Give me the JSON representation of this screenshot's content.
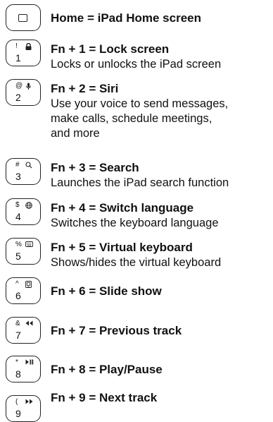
{
  "shortcuts": [
    {
      "key_top": "",
      "key_bottom": "",
      "key_icon": "home-square-icon",
      "title": "Home = iPad Home screen",
      "desc": ""
    },
    {
      "key_top": "!",
      "key_bottom": "1",
      "key_icon": "lock-icon",
      "title": "Fn + 1 = Lock screen",
      "desc": "Locks or unlocks the iPad screen"
    },
    {
      "key_top": "@",
      "key_bottom": "2",
      "key_icon": "microphone-icon",
      "title": "Fn + 2 = Siri",
      "desc": "Use your voice to send messages,\nmake calls, schedule meetings,\nand more"
    },
    {
      "key_top": "#",
      "key_bottom": "3",
      "key_icon": "search-icon",
      "title": "Fn + 3 = Search",
      "desc": "Launches the iPad search function"
    },
    {
      "key_top": "$",
      "key_bottom": "4",
      "key_icon": "globe-icon",
      "title": "Fn + 4 = Switch language",
      "desc": "Switches the keyboard language"
    },
    {
      "key_top": "%",
      "key_bottom": "5",
      "key_icon": "keyboard-icon",
      "title": "Fn + 5 = Virtual keyboard",
      "desc": "Shows/hides the virtual keyboard"
    },
    {
      "key_top": "^",
      "key_bottom": "6",
      "key_icon": "slideshow-icon",
      "title": "Fn + 6 = Slide show",
      "desc": ""
    },
    {
      "key_top": "&",
      "key_bottom": "7",
      "key_icon": "previous-track-icon",
      "title": "Fn + 7 = Previous track",
      "desc": ""
    },
    {
      "key_top": "*",
      "key_bottom": "8",
      "key_icon": "play-pause-icon",
      "title": "Fn + 8 = Play/Pause",
      "desc": ""
    },
    {
      "key_top": "(",
      "key_bottom": "9",
      "key_icon": "next-track-icon",
      "title": "Fn + 9 = Next track",
      "desc": ""
    }
  ]
}
